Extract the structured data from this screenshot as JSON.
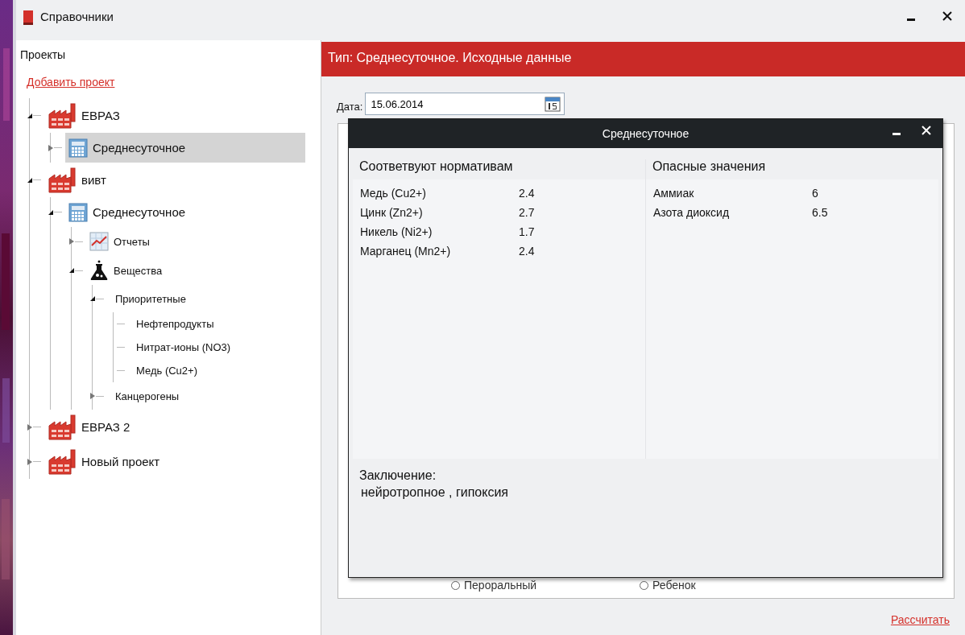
{
  "window": {
    "title": "Справочники"
  },
  "sidebar": {
    "title": "Проекты",
    "add_link": "Добавить проект",
    "tree": [
      {
        "label": "ЕВРАЗ",
        "kind": "factory",
        "expanded": true,
        "selected": false,
        "children": [
          {
            "label": "Среднесуточное",
            "kind": "calculator",
            "expanded": false,
            "selected": true
          }
        ]
      },
      {
        "label": "вивт",
        "kind": "factory",
        "expanded": true,
        "selected": false,
        "children": [
          {
            "label": "Среднесуточное",
            "kind": "calculator",
            "expanded": true,
            "selected": false,
            "children": [
              {
                "label": "Отчеты",
                "kind": "chart",
                "expanded": false,
                "selected": false
              },
              {
                "label": "Вещества",
                "kind": "flask",
                "expanded": true,
                "selected": false,
                "children": [
                  {
                    "label": "Приоритетные",
                    "expanded": true,
                    "selected": false,
                    "children": [
                      {
                        "label": "Нефтепродукты",
                        "selected": false
                      },
                      {
                        "label": "Нитрат-ионы (NO3)",
                        "selected": false
                      },
                      {
                        "label": "Медь (Cu2+)",
                        "selected": false
                      }
                    ]
                  },
                  {
                    "label": "Канцерогены",
                    "expanded": false,
                    "selected": false
                  }
                ]
              }
            ]
          }
        ]
      },
      {
        "label": "ЕВРАЗ 2",
        "kind": "factory",
        "expanded": false,
        "selected": false
      },
      {
        "label": "Новый проект",
        "kind": "factory",
        "expanded": false,
        "selected": false
      }
    ]
  },
  "main": {
    "header": "Тип: Среднесуточное. Исходные данные",
    "date_label": "Дата:",
    "date_value": "15.06.2014",
    "radios": [
      {
        "label": "Пероральный",
        "selected": false
      },
      {
        "label": "Ребенок",
        "selected": false
      }
    ],
    "calculate_link": "Рассчитать"
  },
  "dialog": {
    "title": "Среднесуточное",
    "columns": [
      {
        "heading": "Соответвуют нормативам",
        "rows": [
          {
            "name": "Медь (Cu2+)",
            "value": "2.4"
          },
          {
            "name": "Цинк (Zn2+)",
            "value": "2.7"
          },
          {
            "name": "Никель (Ni2+)",
            "value": "1.7"
          },
          {
            "name": "Марганец (Mn2+)",
            "value": "2.4"
          }
        ]
      },
      {
        "heading": "Опасные значения",
        "rows": [
          {
            "name": "Аммиак",
            "value": "6"
          },
          {
            "name": "Азота диоксид",
            "value": "6.5"
          }
        ]
      }
    ],
    "conclusion_label": "Заключение:",
    "conclusion": "нейротропное ,  гипоксия"
  }
}
